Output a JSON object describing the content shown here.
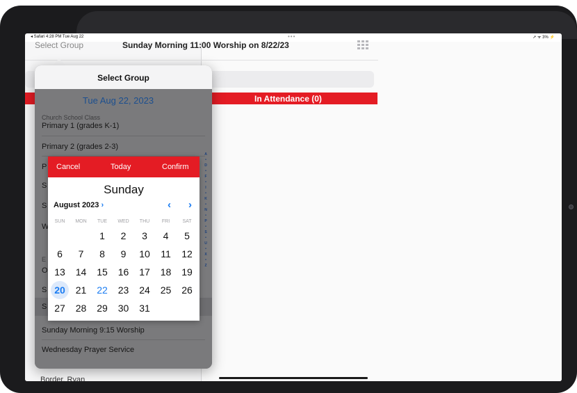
{
  "status_bar": {
    "left": "◂ Safari  4:28 PM  Tue Aug 22",
    "dots": "•••",
    "right": "➚ ᯤ 3% ⚡"
  },
  "navbar": {
    "select_group": "Select Group",
    "title": "Sunday Morning 11:00 Worship on 8/22/23",
    "grid_icon": "grid-icon"
  },
  "attendance_header": "In Attendance (0)",
  "background_rows": [
    "Border, Ryan"
  ],
  "popover": {
    "title": "Select Group",
    "date": "Tue Aug 22, 2023",
    "section_church_school": "Church School Class",
    "rows": [
      {
        "label": "Primary 1 (grades K-1)"
      },
      {
        "label": "Primary 2 (grades 2-3)"
      },
      {
        "label": "P"
      },
      {
        "label": "S"
      },
      {
        "label": "S"
      },
      {
        "label": "W"
      }
    ],
    "section_events": "E",
    "event_rows": [
      {
        "label": "O"
      },
      {
        "label": "S"
      },
      {
        "label": "S"
      },
      {
        "label": "Sunday Morning 9:15 Worship"
      },
      {
        "label": "Wednesday Prayer Service"
      }
    ],
    "index_letters": [
      "A",
      "•",
      "D",
      "•",
      "F",
      "•",
      "I",
      "•",
      "K",
      "•",
      "N",
      "•",
      "P",
      "•",
      "S",
      "•",
      "U",
      "•",
      "X",
      "•",
      "Z"
    ]
  },
  "date_picker": {
    "cancel": "Cancel",
    "today": "Today",
    "confirm": "Confirm",
    "weekday": "Sunday",
    "month": "August 2023",
    "month_chevron": "›",
    "prev": "‹",
    "next": "›",
    "dow": [
      "SUN",
      "MON",
      "TUE",
      "WED",
      "THU",
      "FRI",
      "SAT"
    ],
    "weeks": [
      [
        "",
        "",
        "1",
        "2",
        "3",
        "4",
        "5"
      ],
      [
        "6",
        "7",
        "8",
        "9",
        "10",
        "11",
        "12"
      ],
      [
        "13",
        "14",
        "15",
        "16",
        "17",
        "18",
        "19"
      ],
      [
        "20",
        "21",
        "22",
        "23",
        "24",
        "25",
        "26"
      ],
      [
        "27",
        "28",
        "29",
        "30",
        "31",
        "",
        ""
      ]
    ],
    "selected_day": "20",
    "today_day": "22"
  },
  "colors": {
    "accent_red": "#e41c24",
    "accent_blue": "#1a7cf2",
    "date_blue": "#1c4f8f"
  }
}
